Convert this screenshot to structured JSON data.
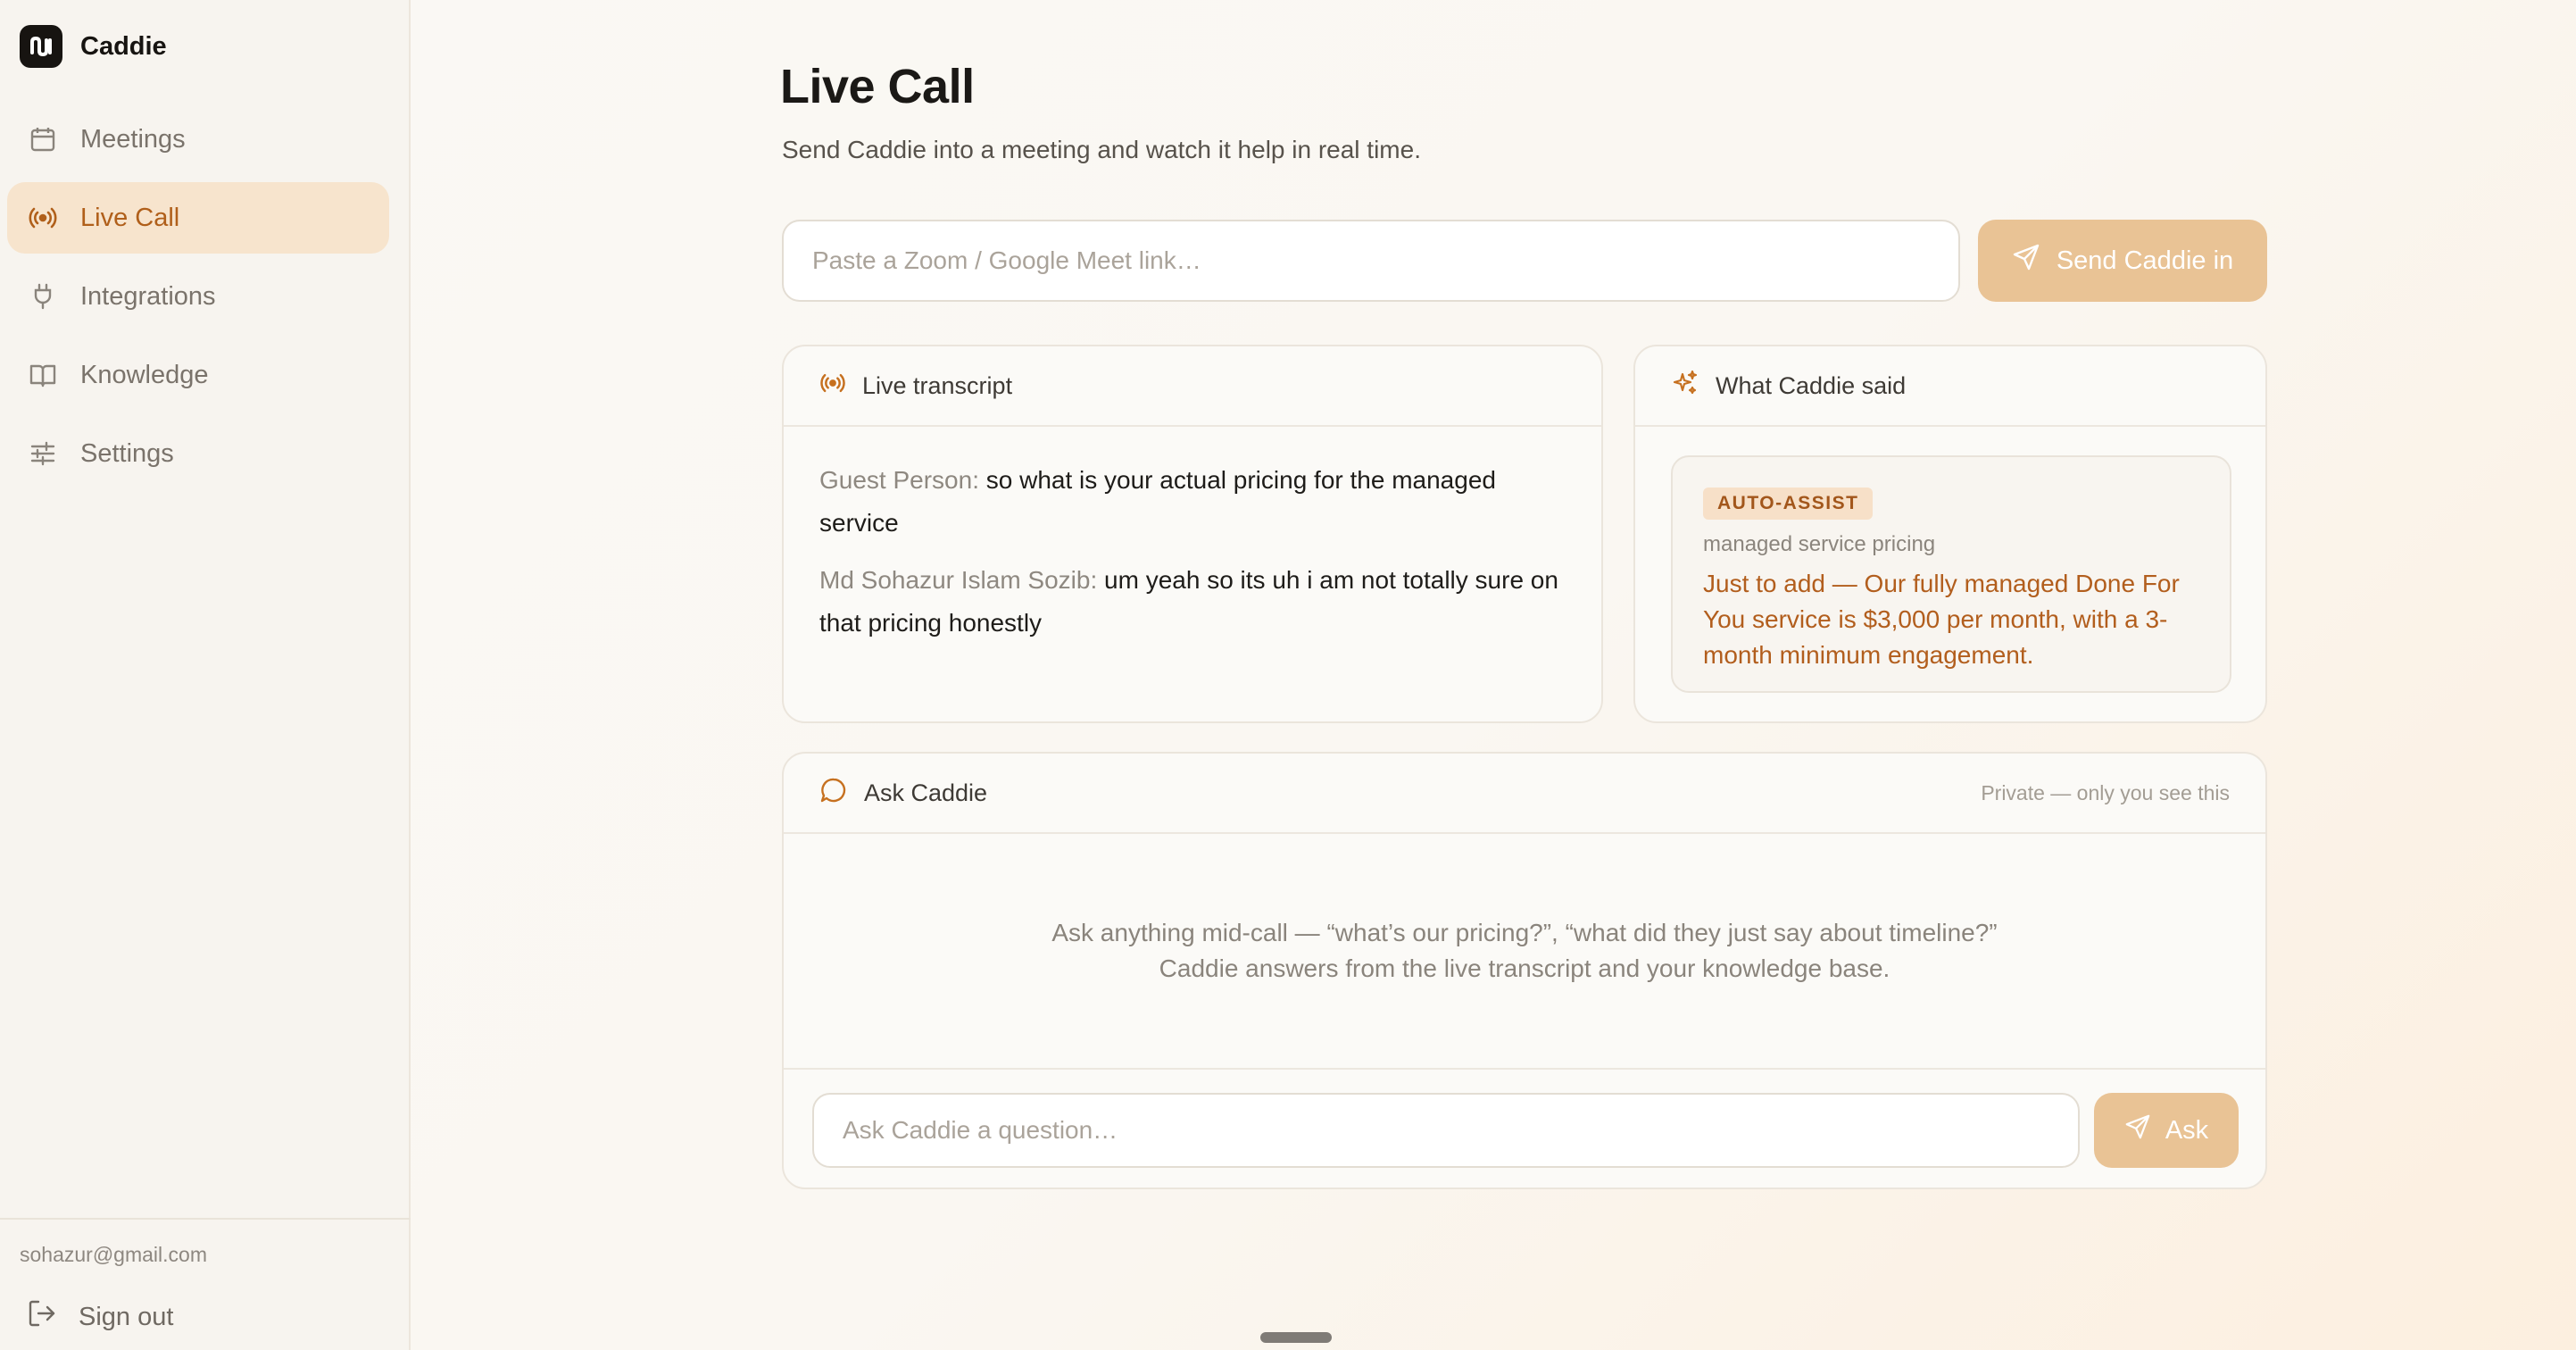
{
  "app": {
    "name": "Caddie"
  },
  "sidebar": {
    "items": [
      {
        "label": "Meetings",
        "icon": "calendar-icon",
        "active": false
      },
      {
        "label": "Live Call",
        "icon": "broadcast-icon",
        "active": true
      },
      {
        "label": "Integrations",
        "icon": "plug-icon",
        "active": false
      },
      {
        "label": "Knowledge",
        "icon": "book-icon",
        "active": false
      },
      {
        "label": "Settings",
        "icon": "sliders-icon",
        "active": false
      }
    ],
    "user_email": "sohazur@gmail.com",
    "sign_out_label": "Sign out"
  },
  "page": {
    "title": "Live Call",
    "subtitle": "Send Caddie into a meeting and watch it help in real time."
  },
  "join": {
    "placeholder": "Paste a Zoom / Google Meet link…",
    "value": "",
    "button_label": "Send Caddie in"
  },
  "transcript": {
    "title": "Live transcript",
    "lines": [
      {
        "speaker": "Guest Person:",
        "text": "so what is your actual pricing for the managed service"
      },
      {
        "speaker": "Md Sohazur Islam Sozib:",
        "text": "um yeah so its uh i am not totally sure on that pricing honestly"
      }
    ]
  },
  "caddie_said": {
    "title": "What Caddie said",
    "badge": "AUTO-ASSIST",
    "topic": "managed service pricing",
    "text": "Just to add — Our fully managed Done For You service is $3,000 per month, with a 3-month minimum engagement."
  },
  "ask": {
    "title": "Ask Caddie",
    "privacy_note": "Private — only you see this",
    "hint_line1": "Ask anything mid-call — “what’s our pricing?”, “what did they just say about timeline?”",
    "hint_line2": "Caddie answers from the live transcript and your knowledge base.",
    "placeholder": "Ask Caddie a question…",
    "button_label": "Ask"
  },
  "colors": {
    "accent": "#b05f1a",
    "accent_soft": "#f7e4cd",
    "button": "#e9c395"
  }
}
